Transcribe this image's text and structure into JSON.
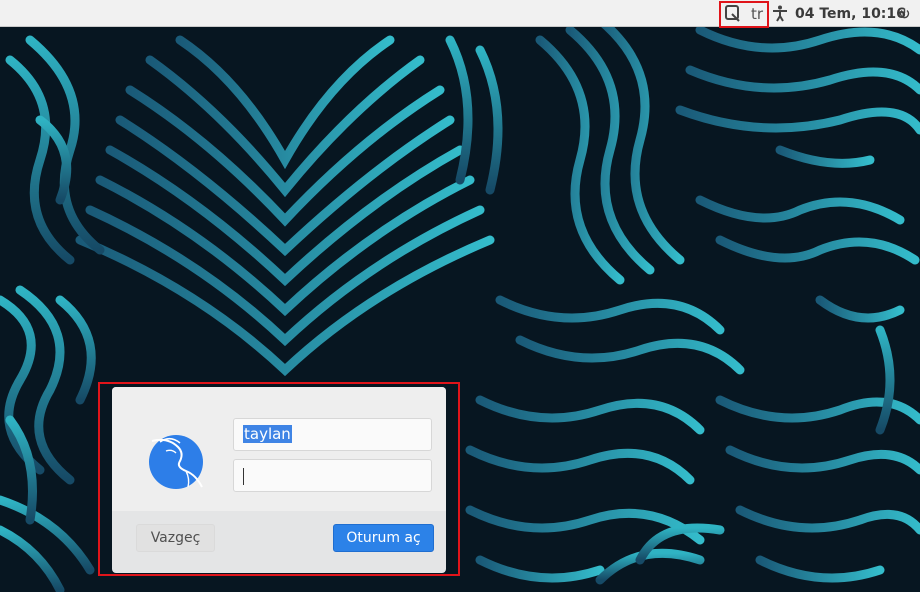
{
  "top_panel": {
    "keyboard_icon": "keyboard-layout-icon",
    "language": "tr",
    "accessibility_icon": "accessibility-icon",
    "clock": "04 Tem, 10:16",
    "power_icon": "power-icon",
    "highlight_color": "#e0141a"
  },
  "login_dialog": {
    "logo": "kali-dragon-logo",
    "username_value": "taylan",
    "password_value": "",
    "cancel_label": "Vazgeç",
    "login_label": "Oturum aç",
    "accent_color": "#2c82e8"
  },
  "wallpaper": {
    "description_icon": "fingerprint-wallpaper",
    "colors": [
      "#071621",
      "#1a5a78",
      "#2fb3c3"
    ]
  }
}
